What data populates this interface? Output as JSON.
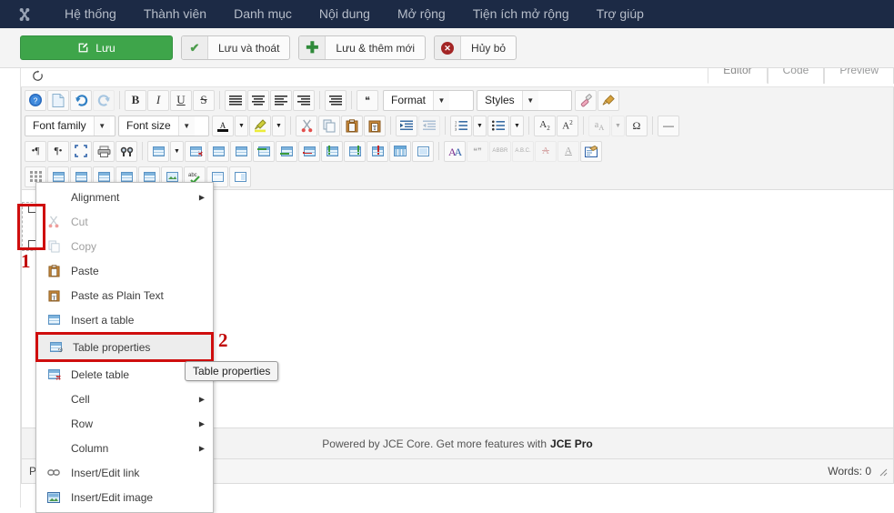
{
  "adminbar": {
    "logo_icon": "joomla-logo-icon",
    "menu": [
      {
        "label": "Hệ thống"
      },
      {
        "label": "Thành viên"
      },
      {
        "label": "Danh mục"
      },
      {
        "label": "Nội dung"
      },
      {
        "label": "Mở rộng"
      },
      {
        "label": "Tiện ích mở rộng"
      },
      {
        "label": "Trợ giúp"
      }
    ]
  },
  "toolbar": {
    "save": {
      "label": "Lưu",
      "icon": "edit-pencil-icon"
    },
    "save_close": {
      "label": "Lưu và thoát",
      "icon": "check-icon"
    },
    "save_new": {
      "label": "Lưu & thêm mới",
      "icon": "plus-icon"
    },
    "cancel": {
      "label": "Hủy bỏ",
      "icon": "cancel-circle-icon"
    }
  },
  "tabs": [
    {
      "label": "Editor",
      "active": true
    },
    {
      "label": "Code",
      "active": false
    },
    {
      "label": "Preview",
      "active": false
    }
  ],
  "editor": {
    "toggle_icon": "refresh-icon",
    "row1": [
      {
        "name": "help-icon",
        "glyph": "?"
      },
      {
        "name": "new-document-icon",
        "glyph": "📄"
      },
      {
        "name": "undo-icon",
        "glyph": "↺"
      },
      {
        "name": "redo-icon",
        "glyph": "↻",
        "disabled": true
      },
      {
        "name": "bold-icon",
        "glyph": "B"
      },
      {
        "name": "italic-icon",
        "glyph": "I"
      },
      {
        "name": "underline-icon",
        "glyph": "U"
      },
      {
        "name": "strikethrough-icon",
        "glyph": "S"
      },
      {
        "name": "align-justify-icon",
        "glyph": "≣"
      },
      {
        "name": "align-center-icon",
        "glyph": "≡"
      },
      {
        "name": "align-left-icon",
        "glyph": "≡"
      },
      {
        "name": "align-right-icon",
        "glyph": "≡"
      },
      {
        "name": "align-full-icon",
        "glyph": "≣"
      },
      {
        "name": "blockquote-icon",
        "glyph": "❝"
      }
    ],
    "format_select": {
      "label": "Format",
      "name": "format-select"
    },
    "styles_select": {
      "label": "Styles",
      "name": "styles-select"
    },
    "row1_end": [
      {
        "name": "remove-format-icon",
        "glyph": "✐"
      },
      {
        "name": "cleanup-icon",
        "glyph": "🧹"
      }
    ],
    "font_family_select": {
      "label": "Font family",
      "name": "font-family-select"
    },
    "font_size_select": {
      "label": "Font size",
      "name": "font-size-select"
    },
    "row2": [
      {
        "name": "text-color-icon",
        "glyph": "A"
      },
      {
        "name": "highlight-color-icon",
        "glyph": "✎"
      },
      {
        "name": "cut-icon",
        "glyph": "✂"
      },
      {
        "name": "copy-icon",
        "glyph": "⧉"
      },
      {
        "name": "paste-icon",
        "glyph": "📋"
      },
      {
        "name": "paste-text-icon",
        "glyph": "T"
      },
      {
        "name": "indent-icon",
        "glyph": "⇥"
      },
      {
        "name": "outdent-icon",
        "glyph": "⇤",
        "disabled": true
      },
      {
        "name": "numbered-list-icon",
        "glyph": "⒈"
      },
      {
        "name": "bullet-list-icon",
        "glyph": "•"
      },
      {
        "name": "subscript-icon",
        "glyph": "A₂"
      },
      {
        "name": "superscript-icon",
        "glyph": "A²"
      },
      {
        "name": "anchor-icon",
        "glyph": "a",
        "disabled": true
      },
      {
        "name": "special-char-icon",
        "glyph": "Ω"
      },
      {
        "name": "horizontal-rule-icon",
        "glyph": "—"
      }
    ],
    "row3": [
      {
        "name": "ltr-icon",
        "glyph": "¶"
      },
      {
        "name": "rtl-icon",
        "glyph": "¶"
      },
      {
        "name": "fullscreen-icon",
        "glyph": "⛶"
      },
      {
        "name": "print-icon",
        "glyph": "🖶"
      },
      {
        "name": "search-replace-icon",
        "glyph": "🔍"
      },
      {
        "name": "insert-table-icon",
        "glyph": "table"
      },
      {
        "name": "delete-table-icon",
        "glyph": "table-x"
      },
      {
        "name": "merge-cells-icon",
        "glyph": "table-merge"
      },
      {
        "name": "split-cells-icon",
        "glyph": "table-split"
      },
      {
        "name": "insert-row-before-icon",
        "glyph": "row-before"
      },
      {
        "name": "insert-row-after-icon",
        "glyph": "row-after"
      },
      {
        "name": "delete-row-icon",
        "glyph": "row-delete"
      },
      {
        "name": "insert-col-before-icon",
        "glyph": "col-before"
      },
      {
        "name": "insert-col-after-icon",
        "glyph": "col-after"
      },
      {
        "name": "delete-col-icon",
        "glyph": "col-delete"
      },
      {
        "name": "table-grid-icon",
        "glyph": "grid"
      },
      {
        "name": "table-cell-props-icon",
        "glyph": "cellprops"
      },
      {
        "name": "styled-text-icon",
        "glyph": "AA"
      },
      {
        "name": "quote-icon",
        "glyph": "❝❞",
        "disabled": true
      },
      {
        "name": "abbreviation-icon",
        "glyph": "ABBR",
        "disabled": true
      },
      {
        "name": "acronym-icon",
        "glyph": "A.B.C.",
        "disabled": true
      },
      {
        "name": "delete-text-icon",
        "glyph": "A",
        "disabled": true
      },
      {
        "name": "insert-text-icon",
        "glyph": "A",
        "disabled": true
      },
      {
        "name": "article-icon",
        "glyph": "📝"
      }
    ],
    "row4": [
      {
        "name": "table-handle-icon",
        "glyph": "grid-dots"
      },
      {
        "name": "unknown-1-icon",
        "glyph": "▤"
      },
      {
        "name": "unknown-2-icon",
        "glyph": "▤"
      },
      {
        "name": "unknown-3-icon",
        "glyph": "▤"
      },
      {
        "name": "unknown-4-icon",
        "glyph": "▤"
      },
      {
        "name": "unknown-5-icon",
        "glyph": "▤"
      },
      {
        "name": "media-icon",
        "glyph": "▤"
      },
      {
        "name": "spellcheck-icon",
        "glyph": "abc✔"
      },
      {
        "name": "page-break-icon",
        "glyph": "▤"
      },
      {
        "name": "layout-icon",
        "glyph": "▣"
      }
    ],
    "footer_text": "Powered by JCE Core. Get more features with",
    "footer_pro": "JCE Pro",
    "status_path": "P",
    "status_words": "Words: 0"
  },
  "context_menu": {
    "items": [
      {
        "label": "Alignment",
        "icon": "alignment-icon",
        "submenu": true,
        "disabled": false,
        "highlighted": false,
        "show_icon": false
      },
      {
        "label": "Cut",
        "icon": "cut-icon",
        "submenu": false,
        "disabled": true,
        "highlighted": false,
        "show_icon": true
      },
      {
        "label": "Copy",
        "icon": "copy-icon",
        "submenu": false,
        "disabled": true,
        "highlighted": false,
        "show_icon": true
      },
      {
        "label": "Paste",
        "icon": "paste-icon",
        "submenu": false,
        "disabled": false,
        "highlighted": false,
        "show_icon": true
      },
      {
        "label": "Paste as Plain Text",
        "icon": "paste-plain-text-icon",
        "submenu": false,
        "disabled": false,
        "highlighted": false,
        "show_icon": true
      },
      {
        "label": "Insert a table",
        "icon": "insert-table-icon",
        "submenu": false,
        "disabled": false,
        "highlighted": false,
        "show_icon": true
      },
      {
        "label": "Table properties",
        "icon": "table-properties-icon",
        "submenu": false,
        "disabled": false,
        "highlighted": true,
        "show_icon": true
      },
      {
        "label": "Delete table",
        "icon": "delete-table-icon",
        "submenu": false,
        "disabled": false,
        "highlighted": false,
        "show_icon": true
      },
      {
        "label": "Cell",
        "icon": "cell-icon",
        "submenu": true,
        "disabled": false,
        "highlighted": false,
        "show_icon": false
      },
      {
        "label": "Row",
        "icon": "row-icon",
        "submenu": true,
        "disabled": false,
        "highlighted": false,
        "show_icon": false
      },
      {
        "label": "Column",
        "icon": "column-icon",
        "submenu": true,
        "disabled": false,
        "highlighted": false,
        "show_icon": false
      },
      {
        "label": "Insert/Edit link",
        "icon": "link-icon",
        "submenu": false,
        "disabled": false,
        "highlighted": false,
        "show_icon": true
      },
      {
        "label": "Insert/Edit image",
        "icon": "image-icon",
        "submenu": false,
        "disabled": false,
        "highlighted": false,
        "show_icon": true
      }
    ]
  },
  "tooltip": {
    "text": "Table properties"
  },
  "annotations": [
    {
      "number": "1"
    },
    {
      "number": "2"
    }
  ],
  "colors": {
    "adminbar_bg": "#1c2a45",
    "primary_green": "#3ea54a",
    "annotation_red": "#cf0e0e"
  }
}
